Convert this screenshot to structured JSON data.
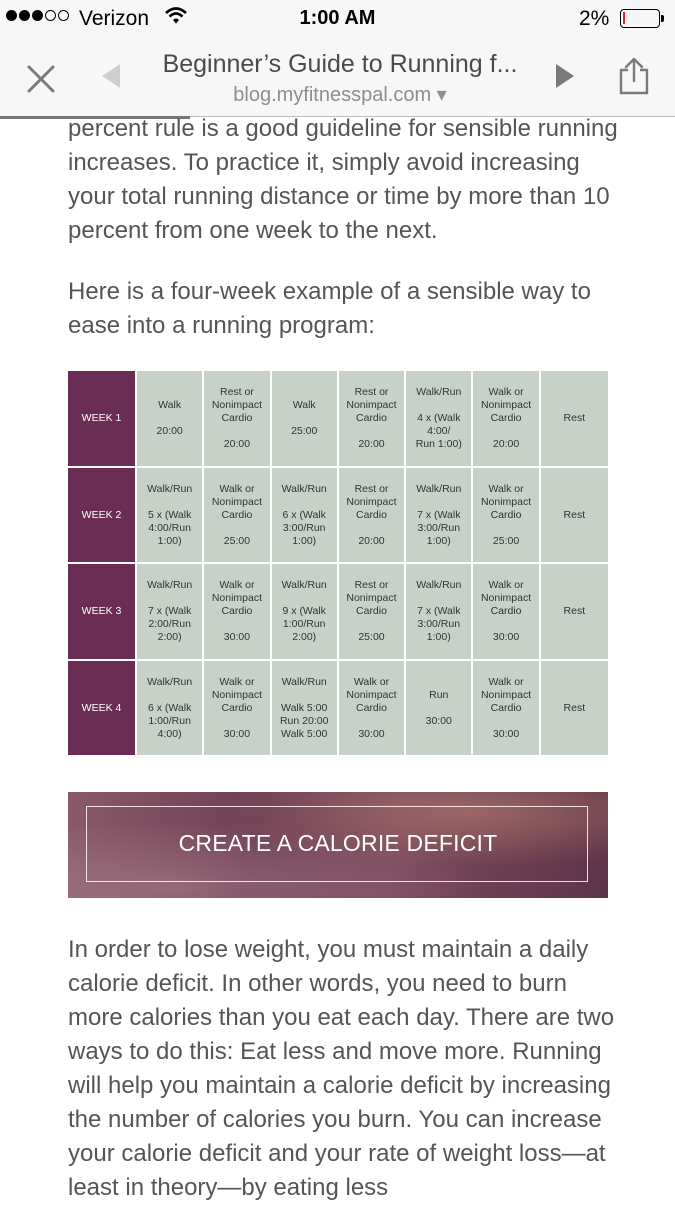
{
  "status_bar": {
    "carrier": "Verizon",
    "time": "1:00 AM",
    "battery": "2%",
    "signal_bars_filled": 3,
    "signal_bars_total": 5
  },
  "browser": {
    "title": "Beginner’s Guide to Running f...",
    "domain": "blog.myfitnesspal.com ▾"
  },
  "article": {
    "top_paragraph": "percent rule is a good guideline for sensible running increases. To practice it, simply avoid increasing your total running distance or time by more than 10 percent from one week to the next.",
    "intro_paragraph": "Here is a four-week example of a sensible way to ease into a running program:",
    "plan": [
      {
        "week": "WEEK 1",
        "cells": [
          "Walk\n\n20:00",
          "Rest or\nNonimpact\nCardio\n\n20:00",
          "Walk\n\n25:00",
          "Rest or\nNonimpact\nCardio\n\n20:00",
          "Walk/Run\n\n4 x (Walk\n4:00/\nRun 1:00)",
          "Walk or\nNonimpact\nCardio\n\n20:00",
          "Rest"
        ]
      },
      {
        "week": "WEEK 2",
        "cells": [
          "Walk/Run\n\n5 x (Walk\n4:00/Run\n1:00)",
          "Walk or\nNonimpact\nCardio\n\n25:00",
          "Walk/Run\n\n6 x (Walk\n3:00/Run\n1:00)",
          "Rest or\nNonimpact\nCardio\n\n20:00",
          "Walk/Run\n\n7 x (Walk\n3:00/Run\n1:00)",
          "Walk or\nNonimpact\nCardio\n\n25:00",
          "Rest"
        ]
      },
      {
        "week": "WEEK 3",
        "cells": [
          "Walk/Run\n\n7 x (Walk\n2:00/Run\n2:00)",
          "Walk or\nNonimpact\nCardio\n\n30:00",
          "Walk/Run\n\n9 x (Walk\n1:00/Run\n2:00)",
          "Rest or\nNonimpact\nCardio\n\n25:00",
          "Walk/Run\n\n7 x (Walk\n3:00/Run\n1:00)",
          "Walk or\nNonimpact\nCardio\n\n30:00",
          "Rest"
        ]
      },
      {
        "week": "WEEK 4",
        "cells": [
          "Walk/Run\n\n6 x (Walk\n1:00/Run\n4:00)",
          "Walk or\nNonimpact\nCardio\n\n30:00",
          "Walk/Run\n\nWalk 5:00\nRun 20:00\nWalk 5:00",
          "Walk or\nNonimpact\nCardio\n\n30:00",
          "Run\n\n30:00",
          "Walk or\nNonimpact\nCardio\n\n30:00",
          "Rest"
        ]
      }
    ],
    "banner_label": "CREATE A CALORIE DEFICIT",
    "bottom_paragraph": "In order to lose weight, you must maintain a daily calorie deficit. In other words, you need to burn more calories than you eat each day. There are two ways to do this: Eat less and move more. Running will help you maintain a calorie deficit by increasing the number of calories you burn. You can increase your calorie deficit and your rate of weight loss—at least in theory—by eating less"
  },
  "icons": {
    "close": "close-icon",
    "back": "chevron-left-icon",
    "forward": "chevron-right-icon",
    "share": "share-icon",
    "wifi": "wifi-icon",
    "battery": "battery-icon"
  },
  "colors": {
    "week_header": "#6a2e56",
    "table_cell": "#c8d1c8",
    "battery_low": "#e0262f"
  }
}
